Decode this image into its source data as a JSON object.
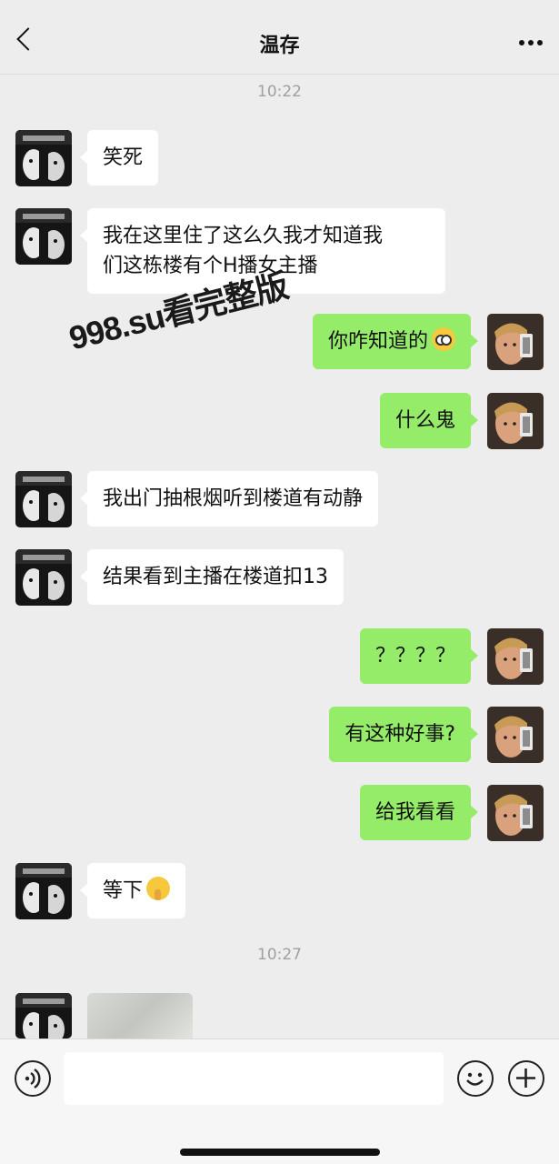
{
  "header": {
    "title": "温存",
    "back_icon": "chevron-left-icon",
    "more_icon": "more-horizontal-icon"
  },
  "timestamps": [
    "10:22",
    "10:27"
  ],
  "messages": [
    {
      "side": "left",
      "lines": [
        "笑死"
      ]
    },
    {
      "side": "left",
      "lines": [
        "我在这里住了这么久我才知道我",
        "们这栋楼有个H播女主播"
      ]
    },
    {
      "side": "right",
      "lines": [
        "你咋知道的"
      ],
      "emoji": "flushed-face"
    },
    {
      "side": "right",
      "lines": [
        "什么鬼"
      ]
    },
    {
      "side": "left",
      "lines": [
        "我出门抽根烟听到楼道有动静"
      ]
    },
    {
      "side": "left",
      "lines": [
        "结果看到主播在楼道扣13"
      ]
    },
    {
      "side": "right",
      "lines": [
        "？？？？"
      ]
    },
    {
      "side": "right",
      "lines": [
        "有这种好事?"
      ]
    },
    {
      "side": "right",
      "lines": [
        "给我看看"
      ]
    },
    {
      "side": "left",
      "lines": [
        "等下"
      ],
      "emoji": "shushing-face"
    }
  ],
  "image_message": {
    "side": "left",
    "type": "image-thumbnail"
  },
  "watermark": "998.su看完整版",
  "composer": {
    "voice_icon": "voice-icon",
    "emoji_icon": "emoji-icon",
    "plus_icon": "plus-icon",
    "placeholder": ""
  },
  "colors": {
    "background": "#ededed",
    "sent_bubble": "#95ec69",
    "received_bubble": "#ffffff",
    "timestamp": "#a0a0a0"
  }
}
